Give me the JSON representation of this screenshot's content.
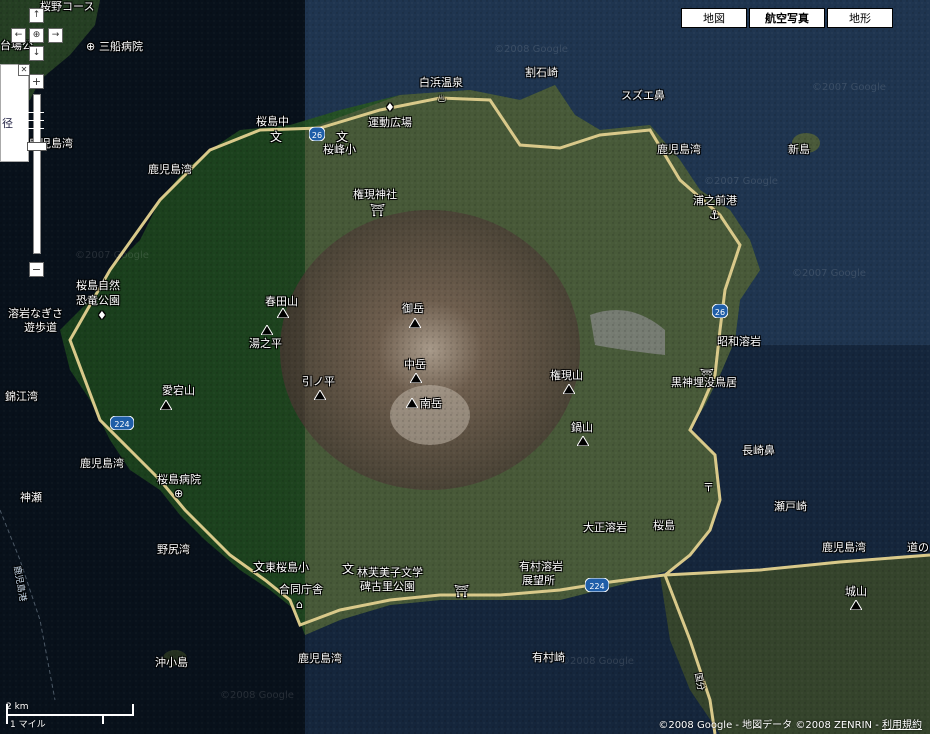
{
  "map_types": [
    {
      "label": "地図",
      "selected": false
    },
    {
      "label": "航空写真",
      "selected": true
    },
    {
      "label": "地形",
      "selected": false
    }
  ],
  "nav": {
    "up": "↑",
    "left": "←",
    "center": "⊕",
    "right": "→",
    "down": "↓",
    "zoom_in": "+",
    "zoom_out": "−",
    "close": "✕"
  },
  "info_panel": {
    "text": "径"
  },
  "scale": {
    "metric": "2 km",
    "imperial": "1 マイル"
  },
  "attribution": {
    "copyright": "©2008 Google - 地図データ ©2008 ZENRIN - ",
    "terms_link": "利用規約"
  },
  "watermarks": [
    "©2008 Google",
    "©2007 Google",
    "©2007 Google",
    "©2007 Google",
    "©2007 Google",
    "©2008 Google",
    "©2008 Google"
  ],
  "labels": [
    {
      "text": "桜野コース",
      "kind": "place"
    },
    {
      "text": "三船病院",
      "kind": "hospital"
    },
    {
      "text": "台場公",
      "kind": "place"
    },
    {
      "text": "白浜温泉",
      "kind": "place"
    },
    {
      "text": "割石崎",
      "kind": "place"
    },
    {
      "text": "スズエ鼻",
      "kind": "place"
    },
    {
      "text": "運動広場",
      "kind": "place"
    },
    {
      "text": "桜島中",
      "kind": "school"
    },
    {
      "text": "桜峰小",
      "kind": "school"
    },
    {
      "text": "鹿児島湾",
      "kind": "water"
    },
    {
      "text": "新島",
      "kind": "place"
    },
    {
      "text": "鹿児島湾",
      "kind": "water"
    },
    {
      "text": "鹿児島湾",
      "kind": "water"
    },
    {
      "text": "権現神社",
      "kind": "shrine"
    },
    {
      "text": "浦之前港",
      "kind": "port"
    },
    {
      "text": "桜島自然",
      "kind": "place"
    },
    {
      "text": "恐竜公園",
      "kind": "place"
    },
    {
      "text": "溶岩なぎさ",
      "kind": "place"
    },
    {
      "text": "遊歩道",
      "kind": "place"
    },
    {
      "text": "春田山",
      "kind": "peak"
    },
    {
      "text": "御岳",
      "kind": "peak"
    },
    {
      "text": "湯之平",
      "kind": "peak"
    },
    {
      "text": "昭和溶岩",
      "kind": "place"
    },
    {
      "text": "中岳",
      "kind": "peak"
    },
    {
      "text": "引ノ平",
      "kind": "peak"
    },
    {
      "text": "権現山",
      "kind": "peak"
    },
    {
      "text": "黒神埋没鳥居",
      "kind": "shrine"
    },
    {
      "text": "錦江湾",
      "kind": "water"
    },
    {
      "text": "愛宕山",
      "kind": "peak"
    },
    {
      "text": "南岳",
      "kind": "peak"
    },
    {
      "text": "鍋山",
      "kind": "peak"
    },
    {
      "text": "長崎鼻",
      "kind": "place"
    },
    {
      "text": "鹿児島湾",
      "kind": "water"
    },
    {
      "text": "桜島病院",
      "kind": "hospital"
    },
    {
      "text": "神瀬",
      "kind": "place"
    },
    {
      "text": "瀬戸崎",
      "kind": "place"
    },
    {
      "text": "大正溶岩",
      "kind": "place"
    },
    {
      "text": "桜島",
      "kind": "place"
    },
    {
      "text": "野尻湾",
      "kind": "water"
    },
    {
      "text": "鹿児島湾",
      "kind": "water"
    },
    {
      "text": "道の",
      "kind": "place"
    },
    {
      "text": "東桜島小",
      "kind": "school"
    },
    {
      "text": "林芙美子文学",
      "kind": "place"
    },
    {
      "text": "碑古里公園",
      "kind": "place"
    },
    {
      "text": "有村溶岩",
      "kind": "place"
    },
    {
      "text": "展望所",
      "kind": "place"
    },
    {
      "text": "合同庁舎",
      "kind": "office"
    },
    {
      "text": "城山",
      "kind": "peak"
    },
    {
      "text": "沖小島",
      "kind": "place"
    },
    {
      "text": "鹿児島湾",
      "kind": "water"
    },
    {
      "text": "有村崎",
      "kind": "place"
    },
    {
      "text": "国分",
      "kind": "place"
    },
    {
      "text": "鹿児島港",
      "kind": "place"
    }
  ],
  "shields": [
    "26",
    "26",
    "224",
    "224"
  ],
  "colors": {
    "sea": "#0f2236",
    "land": "#3d4a2e",
    "volcano": "#6a5a4a",
    "road": "#d9c98a",
    "highway_shield": "#1f5ea8"
  }
}
